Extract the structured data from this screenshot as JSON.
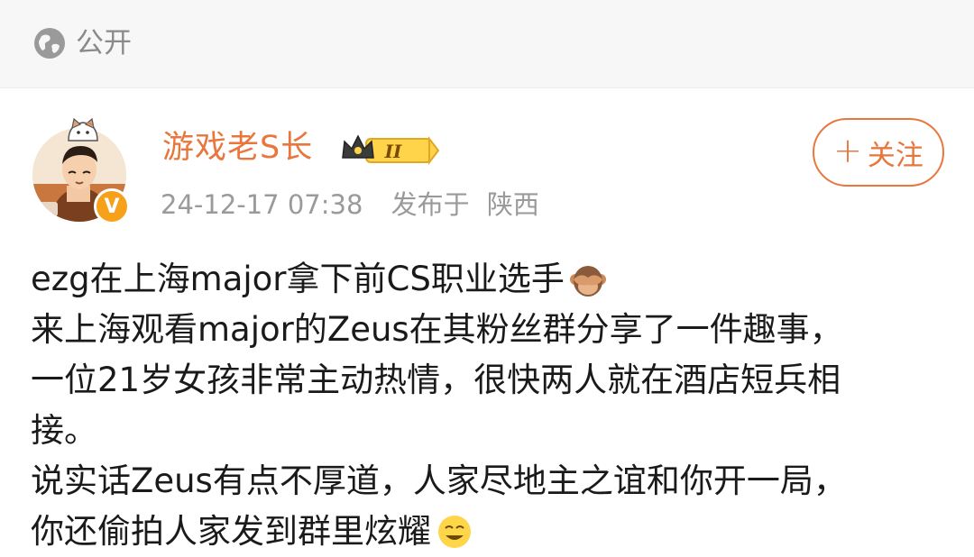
{
  "header": {
    "visibility_label": "公开",
    "visibility_icon": "globe-icon"
  },
  "author": {
    "name": "游戏老S长",
    "member_badge": "II",
    "verified_badge": "V",
    "timestamp": "24-12-17 07:38",
    "source_label": "发布于",
    "location": "陕西"
  },
  "follow_button": {
    "label": "关注",
    "icon": "plus-icon"
  },
  "post": {
    "lines": [
      "ezg在上海major拿下前CS职业选手",
      "来上海观看major的Zeus在其粉丝群分享了一件趣事，",
      "一位21岁女孩非常主动热情，很快两人就在酒店短兵相",
      "接。",
      "说实话Zeus有点不厚道，人家尽地主之谊和你开一局，",
      "你还偷拍人家发到群里炫耀"
    ]
  },
  "colors": {
    "accent": "#e8763d",
    "meta_text": "#9a9a9a",
    "topbar_bg": "#f7f7f7",
    "verified": "#f7a019"
  }
}
